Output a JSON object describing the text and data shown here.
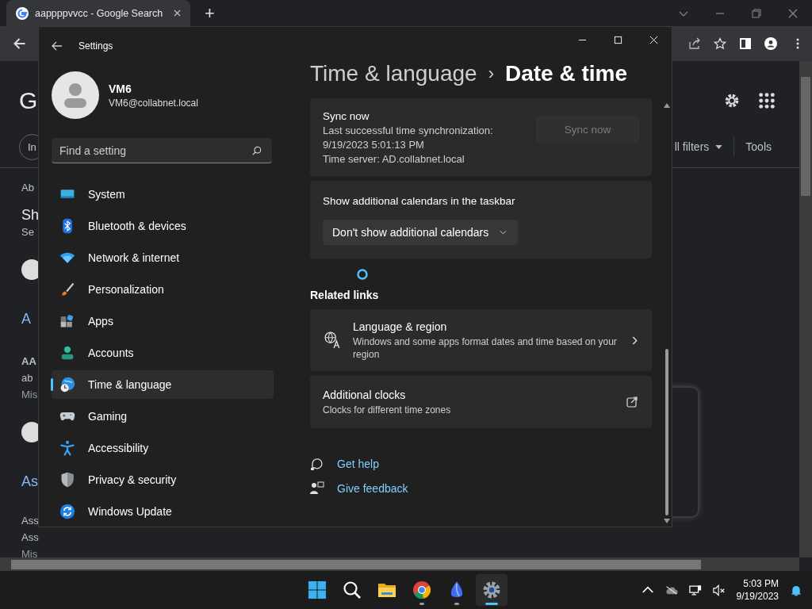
{
  "browser": {
    "tab": {
      "title": "aappppvvcc - Google Search",
      "selected": true
    },
    "new_tab": "+",
    "logo": "G",
    "chip": "In",
    "filters": "ll filters",
    "tools": "Tools",
    "results": [
      {
        "kind": "text",
        "text": "Ab"
      },
      {
        "kind": "title",
        "text": "Sh"
      },
      {
        "kind": "text",
        "text": "Se"
      },
      {
        "kind": "favicon"
      },
      {
        "kind": "link",
        "text": "A"
      },
      {
        "kind": "bold",
        "text": "AA"
      },
      {
        "kind": "text",
        "text": "ab"
      },
      {
        "kind": "muted",
        "text": "Mis"
      },
      {
        "kind": "favicon"
      },
      {
        "kind": "link",
        "text": "As"
      },
      {
        "kind": "text",
        "text": "Ass"
      },
      {
        "kind": "text",
        "text": "Ass"
      },
      {
        "kind": "muted",
        "text": "Mis"
      }
    ]
  },
  "settings": {
    "title": "Settings",
    "user": {
      "name": "VM6",
      "email": "VM6@collabnet.local"
    },
    "search": {
      "placeholder": "Find a setting"
    },
    "nav": [
      {
        "kind": "system",
        "label": "System",
        "selected": false
      },
      {
        "kind": "bluetooth",
        "label": "Bluetooth & devices",
        "selected": false
      },
      {
        "kind": "network",
        "label": "Network & internet",
        "selected": false
      },
      {
        "kind": "brush",
        "label": "Personalization",
        "selected": false
      },
      {
        "kind": "apps",
        "label": "Apps",
        "selected": false
      },
      {
        "kind": "accounts",
        "label": "Accounts",
        "selected": false
      },
      {
        "kind": "time",
        "label": "Time & language",
        "selected": true
      },
      {
        "kind": "gaming",
        "label": "Gaming",
        "selected": false
      },
      {
        "kind": "accessibility",
        "label": "Accessibility",
        "selected": false
      },
      {
        "kind": "privacy",
        "label": "Privacy & security",
        "selected": false
      },
      {
        "kind": "update",
        "label": "Windows Update",
        "selected": false
      }
    ],
    "breadcrumb": {
      "parent": "Time & language",
      "separator": "›",
      "current": "Date & time"
    },
    "sync": {
      "title": "Sync now",
      "lines": [
        "Last successful time synchronization:",
        "9/19/2023 5:01:13 PM",
        "Time server: AD.collabnet.local"
      ],
      "button": "Sync now",
      "disabled": true
    },
    "calendars": {
      "title": "Show additional calendars in the taskbar",
      "dropdown": "Don't show additional calendars"
    },
    "related_title": "Related links",
    "related": [
      {
        "kind": "language",
        "title": "Language & region",
        "description": "Windows and some apps format dates and time based on your region"
      },
      {
        "kind": "external",
        "title": "Additional clocks",
        "description": "Clocks for different time zones"
      }
    ],
    "help": [
      {
        "kind": "help",
        "label": "Get help"
      },
      {
        "kind": "feedback",
        "label": "Give feedback"
      }
    ]
  },
  "taskbar": {
    "apps": [
      {
        "kind": "start",
        "running": false,
        "active": false
      },
      {
        "kind": "search",
        "running": false,
        "active": false
      },
      {
        "kind": "folder",
        "running": false,
        "active": false
      },
      {
        "kind": "chrome",
        "running": true,
        "active": false
      },
      {
        "kind": "app",
        "running": true,
        "active": false
      },
      {
        "kind": "settings",
        "running": true,
        "active": true
      }
    ],
    "time": "5:03 PM",
    "date": "9/19/2023"
  }
}
